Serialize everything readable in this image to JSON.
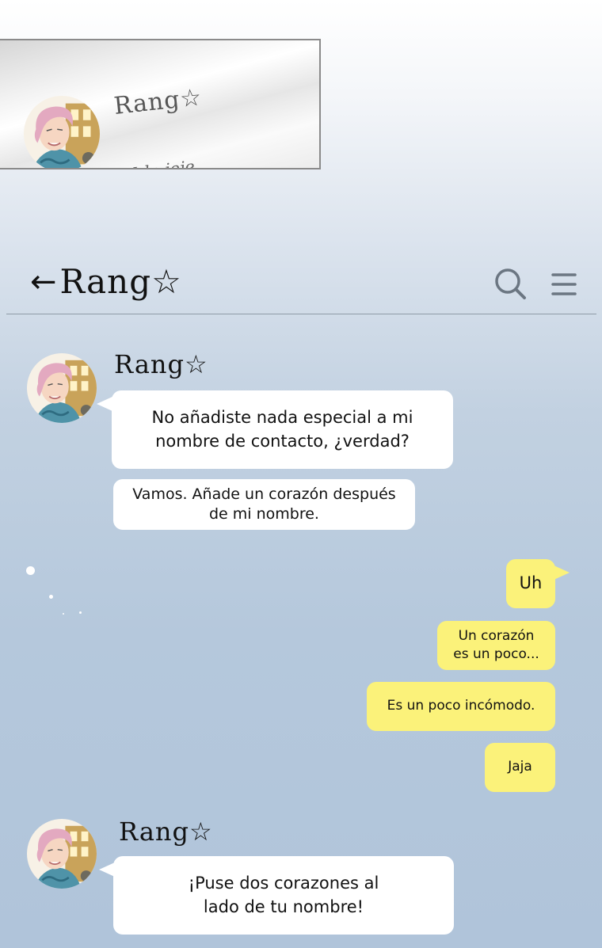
{
  "notification": {
    "contact_name": "Rang☆",
    "preview": "Vale jeje"
  },
  "header": {
    "back_arrow": "←",
    "title": "Rang☆",
    "icons": [
      "search-icon",
      "menu-icon"
    ]
  },
  "messages": [
    {
      "sender": "Rang☆",
      "side": "left",
      "lines": [
        "No añadiste nada especial a mi",
        "nombre de contacto, ¿verdad?"
      ]
    },
    {
      "side": "left",
      "lines": [
        "Vamos. Añade un corazón después",
        "de mi nombre."
      ]
    },
    {
      "side": "right",
      "lines": [
        "Uh"
      ]
    },
    {
      "side": "right",
      "lines": [
        "Un corazón",
        "es un poco..."
      ]
    },
    {
      "side": "right",
      "lines": [
        "Es un poco incómodo."
      ]
    },
    {
      "side": "right",
      "lines": [
        "Jaja"
      ]
    },
    {
      "sender": "Rang☆",
      "side": "left",
      "lines": [
        "¡Puse dos corazones al",
        "lado de tu nombre!"
      ]
    }
  ],
  "colors": {
    "outgoing_bubble": "#fbf27a",
    "incoming_bubble": "#ffffff",
    "background_top": "#ffffff",
    "background_bottom": "#b0c4da"
  }
}
